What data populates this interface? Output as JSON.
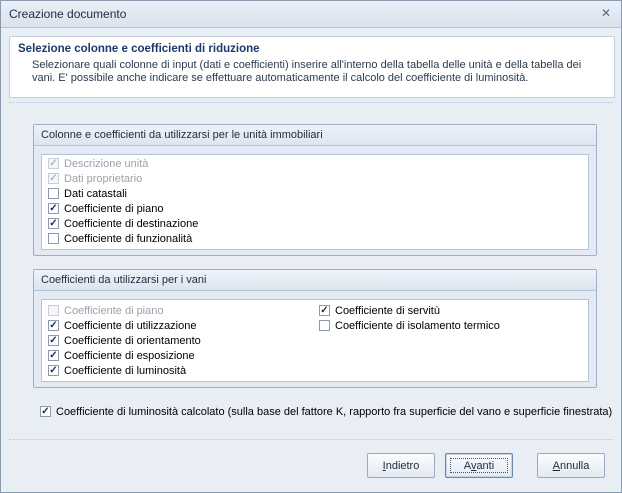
{
  "window": {
    "title": "Creazione documento",
    "close_glyph": "✕"
  },
  "header": {
    "title": "Selezione colonne e coefficienti di riduzione",
    "description": "Selezionare quali colonne di input (dati e coefficienti) inserire all'interno della tabella delle unità e della tabella dei vani. E' possibile anche indicare se effettuare automaticamente il calcolo del coefficiente di luminosità."
  },
  "units_group": {
    "title": "Colonne e coefficienti da utilizzarsi per le unità immobiliari",
    "items": [
      {
        "label": "Descrizione unità",
        "checked": true,
        "enabled": false
      },
      {
        "label": "Dati proprietario",
        "checked": true,
        "enabled": false
      },
      {
        "label": "Dati catastali",
        "checked": false,
        "enabled": true
      },
      {
        "label": "Coefficiente di piano",
        "checked": true,
        "enabled": true
      },
      {
        "label": "Coefficiente di destinazione",
        "checked": true,
        "enabled": true
      },
      {
        "label": "Coefficiente di funzionalità",
        "checked": false,
        "enabled": true
      }
    ]
  },
  "rooms_group": {
    "title": "Coefficienti da utilizzarsi per i vani",
    "left_items": [
      {
        "label": "Coefficiente di piano",
        "checked": false,
        "enabled": false
      },
      {
        "label": "Coefficiente di utilizzazione",
        "checked": true,
        "enabled": true
      },
      {
        "label": "Coefficiente di orientamento",
        "checked": true,
        "enabled": true
      },
      {
        "label": "Coefficiente di esposizione",
        "checked": true,
        "enabled": true
      },
      {
        "label": "Coefficiente di luminosità",
        "checked": true,
        "enabled": true
      }
    ],
    "right_items": [
      {
        "label": "Coefficiente di servitù",
        "checked": true,
        "enabled": true
      },
      {
        "label": "Coefficiente di isolamento termico",
        "checked": false,
        "enabled": true
      }
    ]
  },
  "luminosity_option": {
    "label": "Coefficiente di luminosità calcolato (sulla base del fattore K, rapporto fra superficie del vano e superficie finestrata)",
    "checked": true
  },
  "buttons": {
    "back": {
      "u": "I",
      "rest": "ndietro"
    },
    "next": {
      "pre": "A",
      "u": "v",
      "rest": "anti"
    },
    "cancel": {
      "u": "A",
      "rest": "nnulla"
    }
  }
}
